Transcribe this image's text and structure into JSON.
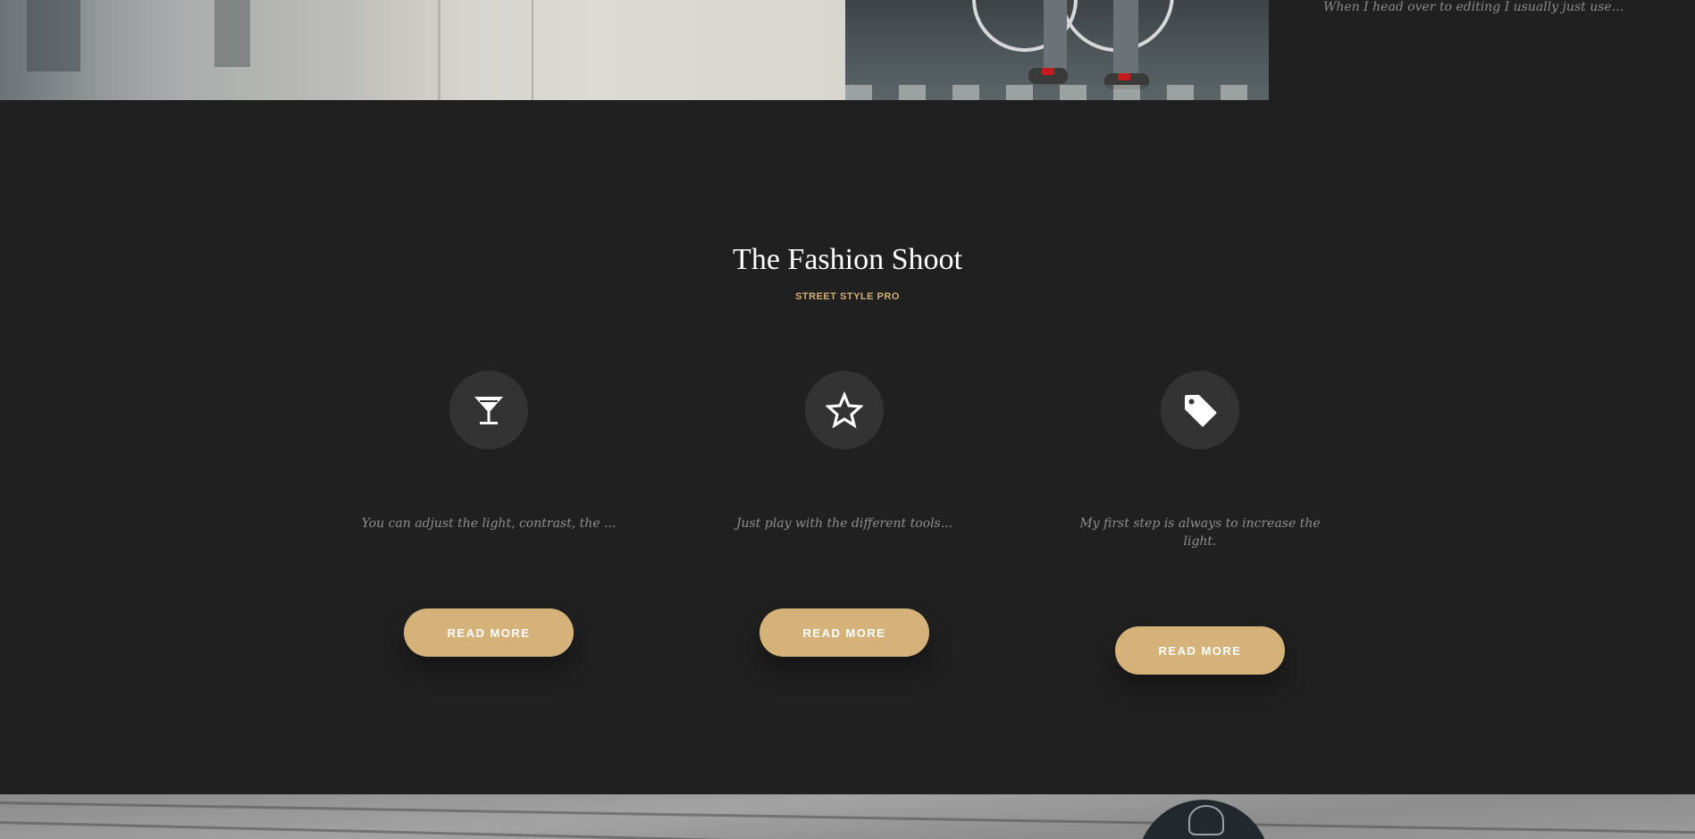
{
  "side_post": {
    "excerpt": "When I head over to editing I usually just use..."
  },
  "section": {
    "title": "The Fashion Shoot",
    "subtitle": "STREET STYLE PRO"
  },
  "features": [
    {
      "icon": "martini-glass-icon",
      "text": "You can adjust the light, contrast, the ...",
      "button": "READ MORE"
    },
    {
      "icon": "star-outline-icon",
      "text": "Just play with the different tools...",
      "button": "READ MORE"
    },
    {
      "icon": "tag-icon",
      "text": "My first step is always to increase the light.",
      "button": "READ MORE"
    }
  ],
  "colors": {
    "background": "#202020",
    "accent": "#d5b27a",
    "icon_circle": "#333333",
    "muted_text": "#8e8e8e"
  }
}
